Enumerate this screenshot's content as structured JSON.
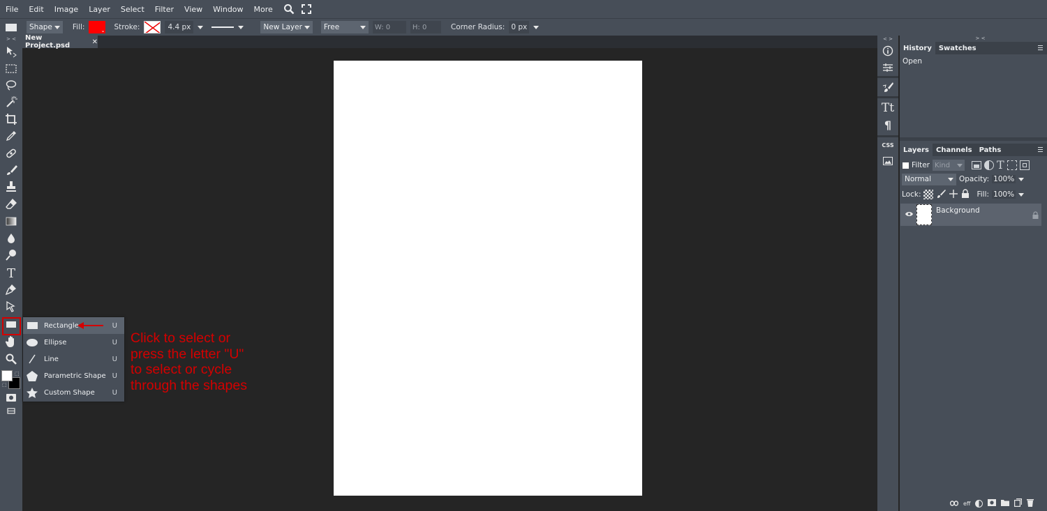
{
  "menu": [
    "File",
    "Edit",
    "Image",
    "Layer",
    "Select",
    "Filter",
    "View",
    "Window",
    "More"
  ],
  "options": {
    "tool_type": "Shape",
    "fill_label": "Fill:",
    "fill_color": "#ff0000",
    "stroke_label": "Stroke:",
    "stroke_width": "4.4 px",
    "layer_mode": "New Layer",
    "size_mode": "Free",
    "w_label": "W:",
    "w_value": "0",
    "h_label": "H:",
    "h_value": "0",
    "corner_label": "Corner Radius:",
    "corner_value": "0 px"
  },
  "document": {
    "tab_name": "New Project.psd",
    "close": "✕"
  },
  "flyout": [
    {
      "label": "Rectangle",
      "key": "U",
      "icon": "rectangle-icon"
    },
    {
      "label": "Ellipse",
      "key": "U",
      "icon": "ellipse-icon"
    },
    {
      "label": "Line",
      "key": "U",
      "icon": "line-icon"
    },
    {
      "label": "Parametric Shape",
      "key": "U",
      "icon": "pentagon-icon"
    },
    {
      "label": "Custom Shape",
      "key": "U",
      "icon": "star-icon"
    }
  ],
  "annotation": "Click to select or press the letter \"U\" to select or cycle through the shapes",
  "annotation_lines": [
    "Click to select or",
    "press the letter \"U\"",
    "to select or cycle",
    "through the shapes"
  ],
  "collapse_left": "> <",
  "collapse_right": "> <",
  "collapse_strip": "< >",
  "history_panel": {
    "tabs": [
      "History",
      "Swatches"
    ],
    "items": [
      "Open"
    ]
  },
  "layers_panel": {
    "tabs": [
      "Layers",
      "Channels",
      "Paths"
    ],
    "filter_label": "Filter",
    "kind_placeholder": "Kind",
    "blend_mode": "Normal",
    "opacity_label": "Opacity:",
    "opacity_value": "100%",
    "lock_label": "Lock:",
    "fill_label": "Fill:",
    "fill_value": "100%",
    "layers": [
      {
        "name": "Background"
      }
    ],
    "footer_eff": "eff"
  },
  "strip": {
    "css_label": "CSS"
  },
  "colors": {
    "accent_red": "#d40000",
    "panel_bg": "#474e58",
    "workspace_bg": "#252525"
  }
}
